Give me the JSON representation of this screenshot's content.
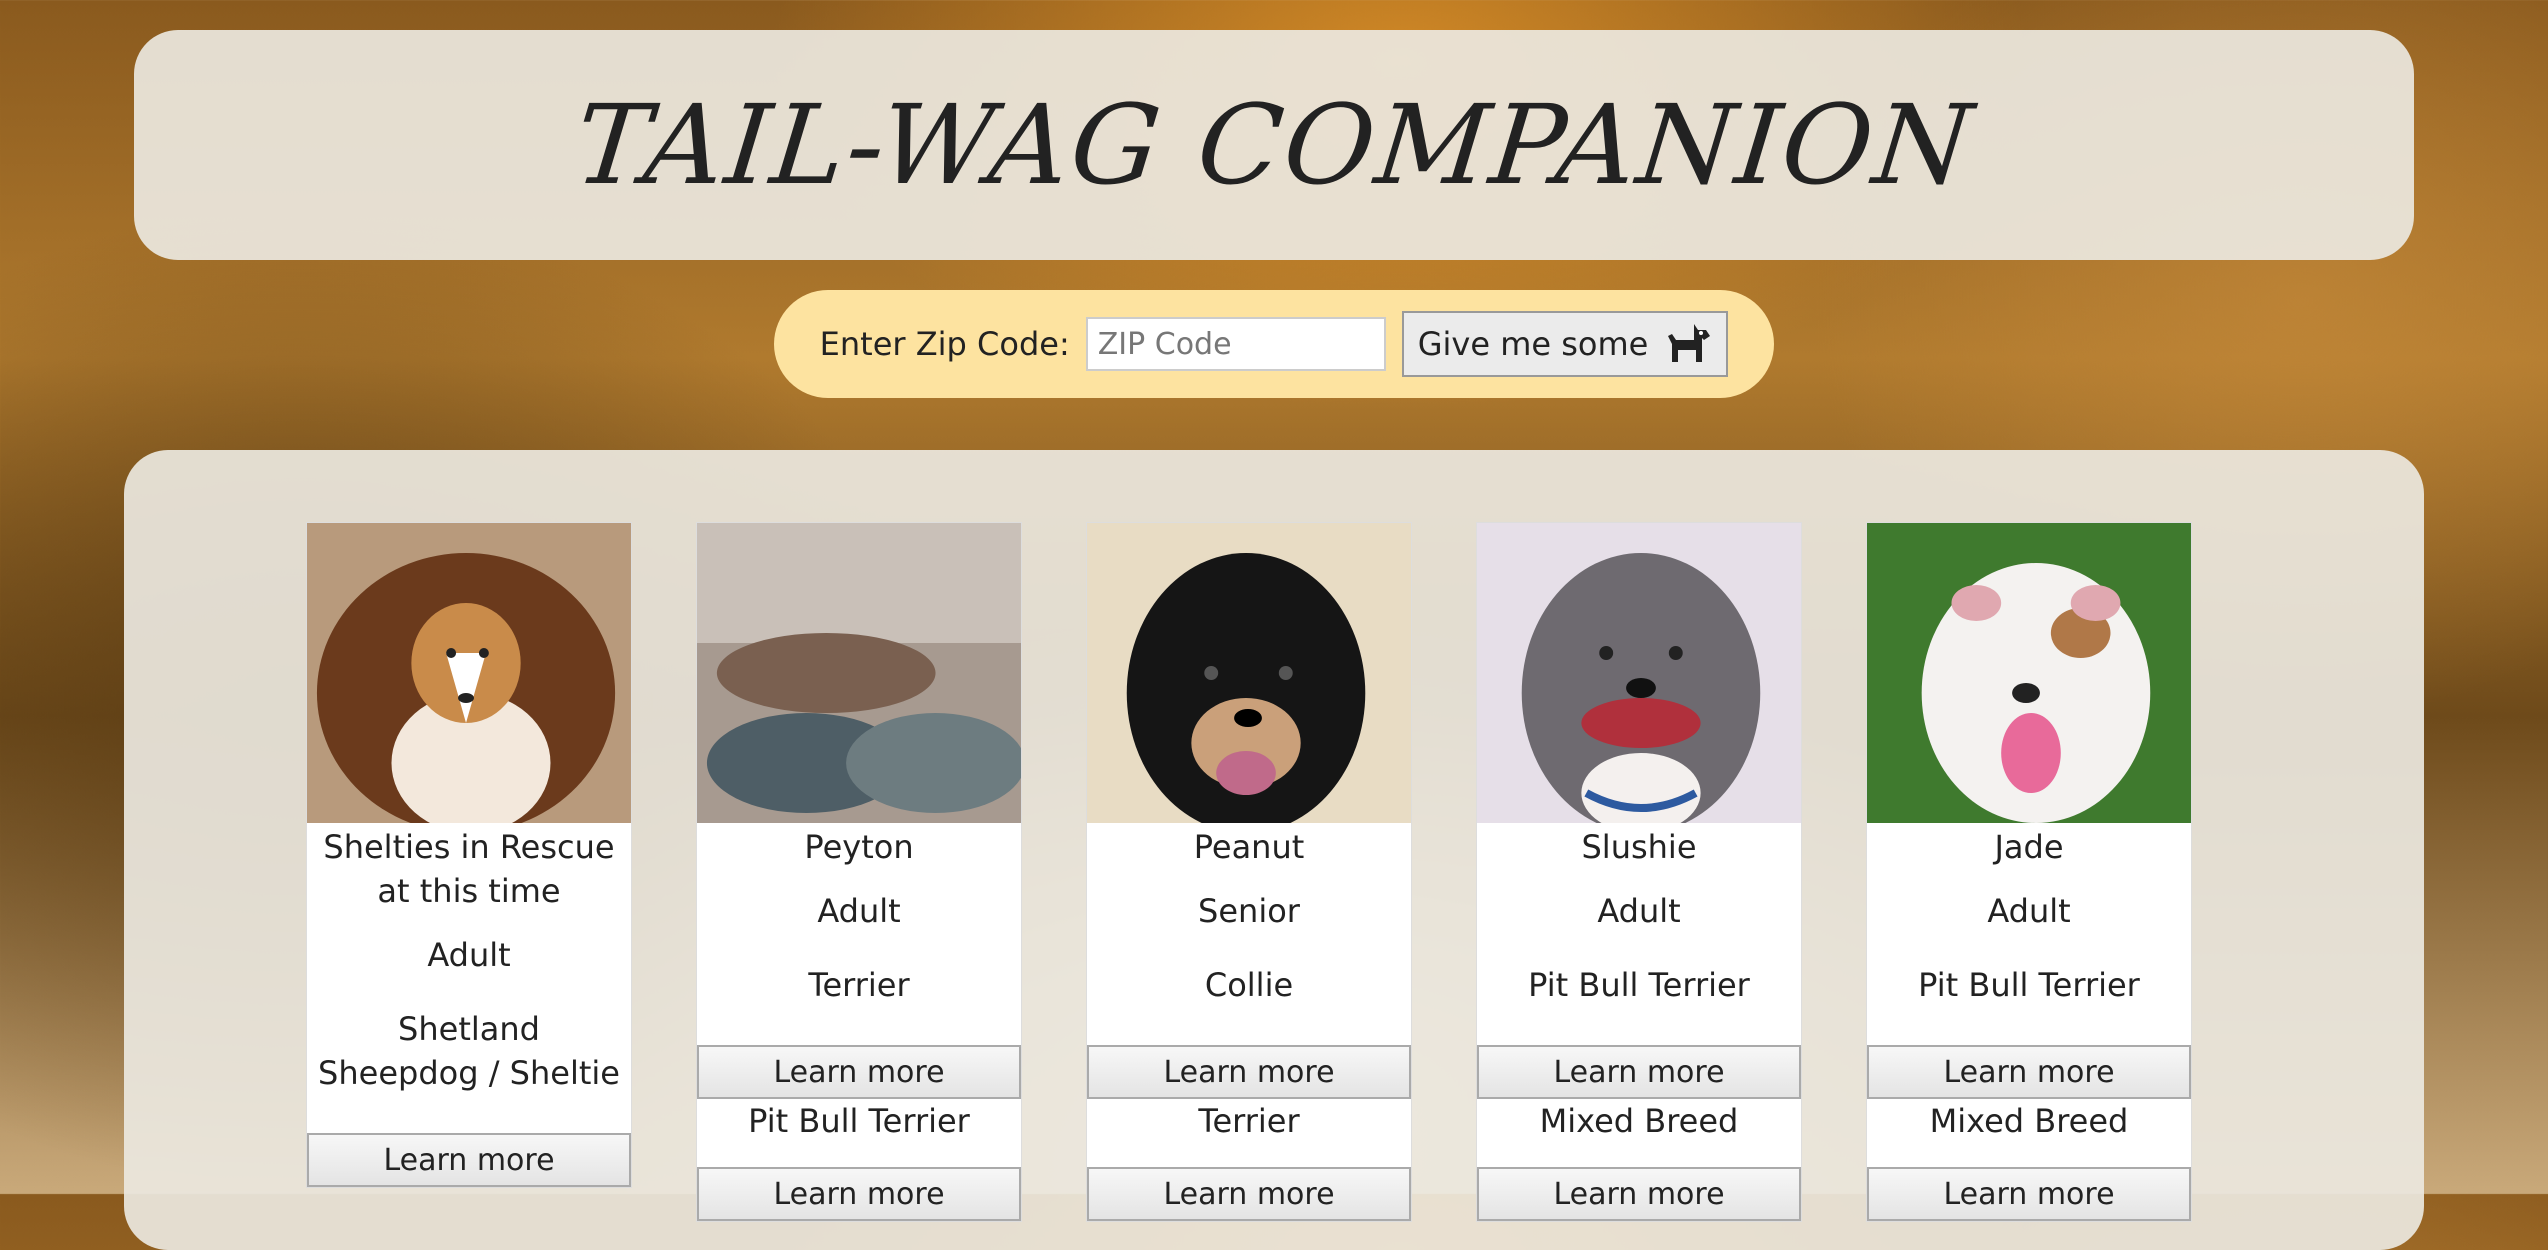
{
  "header": {
    "title": "TAIL-WAG COMPANION"
  },
  "search": {
    "label": "Enter Zip Code:",
    "placeholder": "ZIP Code",
    "button_label": "Give me some",
    "button_icon": "dog-icon"
  },
  "pets": [
    {
      "name": "Shelties in Rescue at this time",
      "age": "Adult",
      "breed": "Shetland Sheepdog / Sheltie",
      "button": "Learn more"
    },
    {
      "name": "Peyton",
      "age": "Adult",
      "breed": "Terrier",
      "button": "Learn more",
      "next_breed": "Pit Bull Terrier",
      "next_button": "Learn more"
    },
    {
      "name": "Peanut",
      "age": "Senior",
      "breed": "Collie",
      "button": "Learn more",
      "next_breed": "Terrier",
      "next_button": "Learn more"
    },
    {
      "name": "Slushie",
      "age": "Adult",
      "breed": "Pit Bull Terrier",
      "button": "Learn more",
      "next_breed": "Mixed Breed",
      "next_button": "Learn more"
    },
    {
      "name": "Jade",
      "age": "Adult",
      "breed": "Pit Bull Terrier",
      "button": "Learn more",
      "next_breed": "Mixed Breed",
      "next_button": "Learn more"
    }
  ]
}
